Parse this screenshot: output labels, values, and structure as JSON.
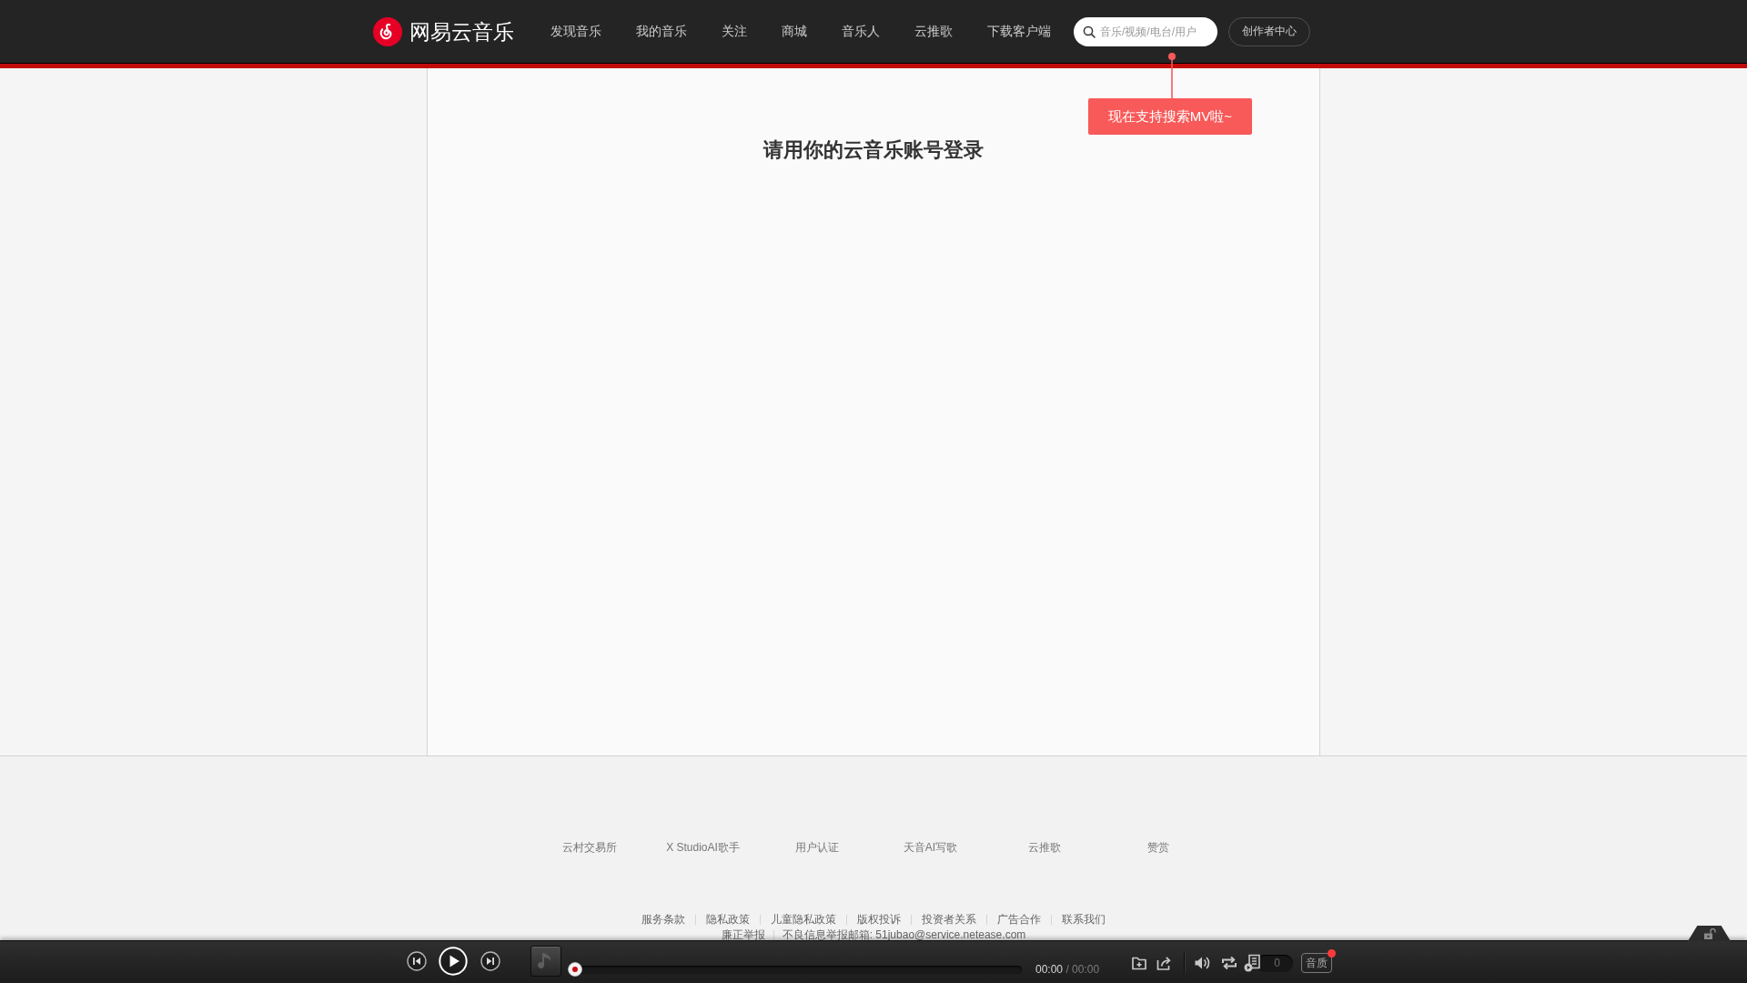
{
  "header": {
    "logo_text": "网易云音乐",
    "nav": [
      {
        "label": "发现音乐",
        "selected": false
      },
      {
        "label": "我的音乐",
        "selected": false
      },
      {
        "label": "关注",
        "selected": false
      },
      {
        "label": "商城",
        "selected": false
      },
      {
        "label": "音乐人",
        "selected": false
      },
      {
        "label": "云推歌",
        "selected": false
      },
      {
        "label": "下载客户端",
        "selected": false
      }
    ],
    "search": {
      "placeholder": "音乐/视频/电台/用户"
    },
    "creator_button": "创作者中心",
    "tip": "现在支持搜索MV啦~"
  },
  "main": {
    "title": "请用你的云音乐账号登录"
  },
  "footer": {
    "services": [
      "云村交易所",
      "X StudioAI歌手",
      "用户认证",
      "天音AI写歌",
      "云推歌",
      "赞赏"
    ],
    "links": [
      "服务条款",
      "隐私政策",
      "儿童隐私政策",
      "版权投诉",
      "投资者关系",
      "广告合作",
      "联系我们"
    ],
    "report_links": [
      "廉正举报",
      "不良信息举报邮箱: 51jubao@service.netease.com"
    ]
  },
  "player": {
    "playing": false,
    "progress": {
      "level": 0
    },
    "elapsed": "00:00",
    "separator": "/",
    "duration": "00:00",
    "playlist_count": "0",
    "quality_button": "音质",
    "quality_dot": true,
    "locked": false
  }
}
